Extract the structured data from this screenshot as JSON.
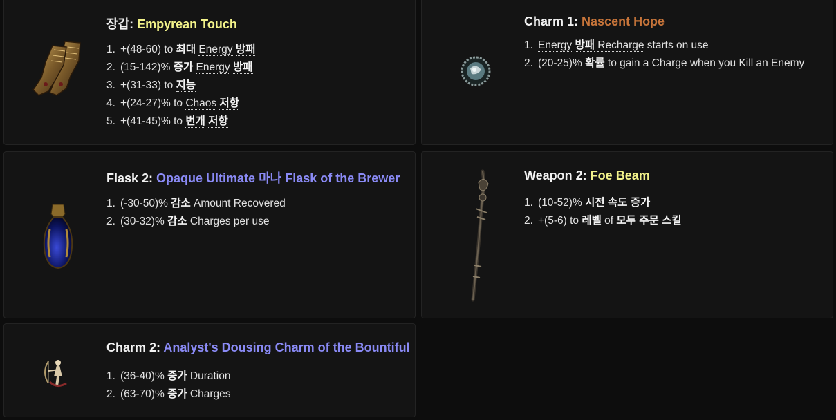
{
  "colors": {
    "unique": "#f3f38a",
    "rare": "#f3f38a",
    "unique_orange": "#c8753a",
    "magic": "#8a8af5",
    "background": "#0d0d0d",
    "card": "#141414"
  },
  "cards": [
    {
      "slot": "장갑: ",
      "name": "Empyrean Touch",
      "icon": "gauntlets-icon",
      "mods": [
        {
          "n": "1.",
          "parts": [
            {
              "t": "+(48-60) to "
            },
            {
              "t": "최대",
              "k": 1
            },
            {
              "t": " "
            },
            {
              "t": "Energy",
              "u": 1
            },
            {
              "t": " "
            },
            {
              "t": "방패",
              "k": 1,
              "u": 1
            }
          ]
        },
        {
          "n": "2.",
          "parts": [
            {
              "t": "(15-142)% "
            },
            {
              "t": "증가",
              "k": 1
            },
            {
              "t": " "
            },
            {
              "t": "Energy",
              "u": 1
            },
            {
              "t": " "
            },
            {
              "t": "방패",
              "k": 1,
              "u": 1
            }
          ]
        },
        {
          "n": "3.",
          "parts": [
            {
              "t": "+(31-33) to "
            },
            {
              "t": "지능",
              "k": 1,
              "u": 1
            }
          ]
        },
        {
          "n": "4.",
          "parts": [
            {
              "t": "+(24-27)% to "
            },
            {
              "t": "Chaos",
              "u": 1
            },
            {
              "t": " "
            },
            {
              "t": "저항",
              "k": 1,
              "u": 1
            }
          ]
        },
        {
          "n": "5.",
          "parts": [
            {
              "t": "+(41-45)% to "
            },
            {
              "t": "번개",
              "k": 1,
              "u": 1
            },
            {
              "t": " "
            },
            {
              "t": "저항",
              "k": 1,
              "u": 1
            }
          ]
        }
      ]
    },
    {
      "slot": "Charm 1: ",
      "name": "Nascent Hope",
      "icon": "charm-amulet-icon",
      "mods": [
        {
          "n": "1.",
          "parts": [
            {
              "t": "Energy",
              "u": 1
            },
            {
              "t": " "
            },
            {
              "t": "방패",
              "k": 1,
              "u": 1
            },
            {
              "t": " "
            },
            {
              "t": "Recharge",
              "u": 1
            },
            {
              "t": " starts on use"
            }
          ]
        },
        {
          "n": "2.",
          "parts": [
            {
              "t": "(20-25)% "
            },
            {
              "t": "확률",
              "k": 1
            },
            {
              "t": " to gain a Charge when you Kill an Enemy"
            }
          ]
        }
      ]
    },
    {
      "slot": "Flask 2: ",
      "name": "Opaque Ultimate 마나 Flask of the Brewer",
      "icon": "mana-flask-icon",
      "mods": [
        {
          "n": "1.",
          "parts": [
            {
              "t": "(-30-50)% "
            },
            {
              "t": "감소",
              "k": 1
            },
            {
              "t": " Amount Recovered"
            }
          ]
        },
        {
          "n": "2.",
          "parts": [
            {
              "t": "(30-32)% "
            },
            {
              "t": "감소",
              "k": 1
            },
            {
              "t": " Charges per use"
            }
          ]
        }
      ]
    },
    {
      "slot": "Weapon 2: ",
      "name": "Foe Beam",
      "icon": "staff-icon",
      "mods": [
        {
          "n": "1.",
          "parts": [
            {
              "t": "(10-52)% "
            },
            {
              "t": "시전 속도 증가",
              "k": 1
            }
          ]
        },
        {
          "n": "2.",
          "parts": [
            {
              "t": "+(5-6) to "
            },
            {
              "t": "레벨",
              "k": 1
            },
            {
              "t": " of "
            },
            {
              "t": "모두",
              "k": 1
            },
            {
              "t": " "
            },
            {
              "t": "주문",
              "k": 1,
              "u": 1
            },
            {
              "t": " "
            },
            {
              "t": "스킬",
              "k": 1
            }
          ]
        }
      ]
    },
    {
      "slot": "Charm 2: ",
      "name": "Analyst's Dousing Charm of the Bountiful",
      "icon": "archer-charm-icon",
      "mods": [
        {
          "n": "1.",
          "parts": [
            {
              "t": "(36-40)% "
            },
            {
              "t": "증가",
              "k": 1
            },
            {
              "t": " Duration"
            }
          ]
        },
        {
          "n": "2.",
          "parts": [
            {
              "t": "(63-70)% "
            },
            {
              "t": "증가",
              "k": 1
            },
            {
              "t": " Charges"
            }
          ]
        }
      ]
    }
  ]
}
